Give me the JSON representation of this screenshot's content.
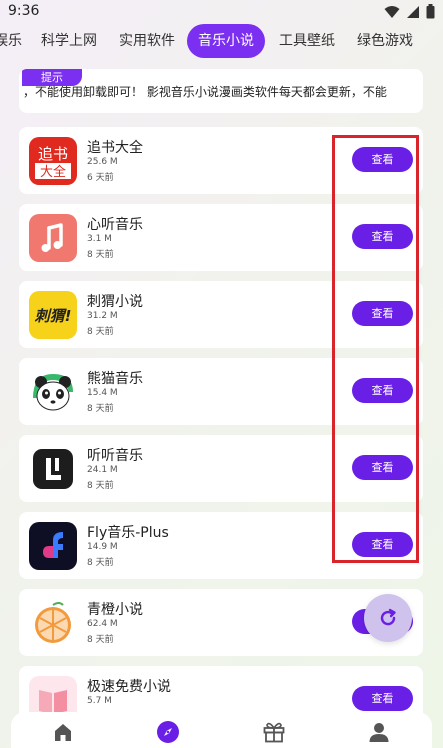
{
  "status_bar": {
    "time": "9:36"
  },
  "tabs": [
    {
      "label": "娱乐",
      "active": false
    },
    {
      "label": "科学上网",
      "active": false
    },
    {
      "label": "实用软件",
      "active": false
    },
    {
      "label": "音乐小说",
      "active": true
    },
    {
      "label": "工具壁纸",
      "active": false
    },
    {
      "label": "绿色游戏",
      "active": false
    }
  ],
  "notice": {
    "badge": "提示",
    "text": "，不能使用卸载即可！   影视音乐小说漫画类软件每天都会更新，不能"
  },
  "apps": [
    {
      "name": "追书大全",
      "size": "25.6 M",
      "time": "6 天前",
      "button": "查看",
      "icon": "zhuishu-logo-icon"
    },
    {
      "name": "心听音乐",
      "size": "3.1 M",
      "time": "8 天前",
      "button": "查看",
      "icon": "music-note-icon"
    },
    {
      "name": "刺猬小说",
      "size": "31.2 M",
      "time": "8 天前",
      "button": "查看",
      "icon": "ciwei-logo-icon"
    },
    {
      "name": "熊猫音乐",
      "size": "15.4 M",
      "time": "8 天前",
      "button": "查看",
      "icon": "panda-icon"
    },
    {
      "name": "听听音乐",
      "size": "24.1 M",
      "time": "8 天前",
      "button": "查看",
      "icon": "tingting-logo-icon"
    },
    {
      "name": "Fly音乐-Plus",
      "size": "14.9 M",
      "time": "8 天前",
      "button": "查看",
      "icon": "fly-logo-icon"
    },
    {
      "name": "青橙小说",
      "size": "62.4 M",
      "time": "8 天前",
      "button": "查看",
      "icon": "orange-slice-icon"
    },
    {
      "name": "极速免费小说",
      "size": "5.7 M",
      "time": "",
      "button": "查看",
      "icon": "book-icon"
    }
  ],
  "bottom_nav": [
    {
      "icon": "home-icon",
      "active": false
    },
    {
      "icon": "compass-icon",
      "active": true
    },
    {
      "icon": "gift-icon",
      "active": false
    },
    {
      "icon": "profile-icon",
      "active": false
    }
  ],
  "colors": {
    "accent": "#7b2ff0",
    "button": "#6a1fe6",
    "highlight": "#d8242a"
  }
}
